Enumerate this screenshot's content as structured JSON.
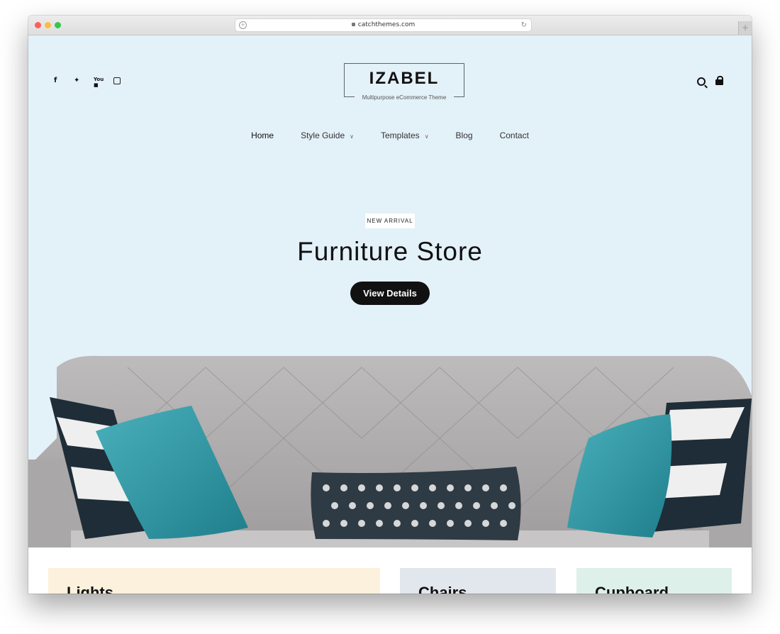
{
  "browser": {
    "url": "catchthemes.com"
  },
  "header": {
    "social_icons": [
      "facebook-icon",
      "twitter-icon",
      "youtube-icon",
      "instagram-icon"
    ],
    "logo": {
      "name": "IZABEL",
      "tagline": "Multipurpose eCommerce Theme"
    },
    "right_icons": [
      "search-icon",
      "shopping-bag-icon"
    ]
  },
  "nav": {
    "items": [
      {
        "label": "Home",
        "active": true,
        "dropdown": false
      },
      {
        "label": "Style Guide",
        "active": false,
        "dropdown": true
      },
      {
        "label": "Templates",
        "active": false,
        "dropdown": true
      },
      {
        "label": "Blog",
        "active": false,
        "dropdown": false
      },
      {
        "label": "Contact",
        "active": false,
        "dropdown": false
      }
    ]
  },
  "hero": {
    "badge": "NEW ARRIVAL",
    "title": "Furniture Store",
    "button_label": "View Details",
    "image": "grey tufted sofa with teal and striped pillows"
  },
  "categories": [
    {
      "title": "Lights",
      "color": "#fcf1dc"
    },
    {
      "title": "Chairs",
      "color": "#e2e6ed"
    },
    {
      "title": "Cupboard",
      "color": "#def0ea"
    }
  ],
  "colors": {
    "hero_bg": "#e3f1f9",
    "button_bg": "#111111",
    "accent_teal": "#2b8f9c"
  }
}
